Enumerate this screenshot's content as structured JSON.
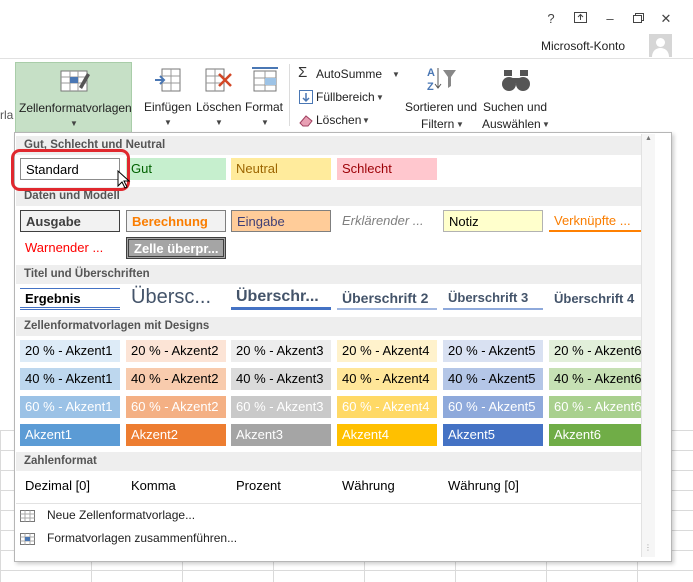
{
  "window": {
    "help": "?",
    "account": "Microsoft-Konto",
    "left_fragment": "rla"
  },
  "ribbon": {
    "zellenformat": "Zellenformatvorlagen",
    "einfuegen": "Einfügen",
    "loeschen": "Löschen",
    "format": "Format",
    "autosumme": "AutoSumme",
    "fuellbereich": "Füllbereich",
    "loeschen2": "Löschen",
    "sortieren1": "Sortieren und",
    "sortieren2": "Filtern",
    "suchen1": "Suchen und",
    "suchen2": "Auswählen"
  },
  "sections": [
    "Gut, Schlecht und Neutral",
    "Daten und Modell",
    "Titel und Überschriften",
    "Zellenformatvorlagen mit Designs",
    "Zahlenformat"
  ],
  "row1": [
    "Standard",
    "Gut",
    "Neutral",
    "Schlecht"
  ],
  "row2": [
    "Ausgabe",
    "Berechnung",
    "Eingabe",
    "Erklärender ...",
    "Notiz",
    "Verknüpfte ..."
  ],
  "row3": [
    "Warnender ...",
    "Zelle überpr..."
  ],
  "row4": [
    "Ergebnis",
    "Übersc...",
    "Überschr...",
    "Überschrift 2",
    "Überschrift 3",
    "Überschrift 4"
  ],
  "accent20": [
    "20 % - Akzent1",
    "20 % - Akzent2",
    "20 % - Akzent3",
    "20 % - Akzent4",
    "20 % - Akzent5",
    "20 % - Akzent6"
  ],
  "accent40": [
    "40 % - Akzent1",
    "40 % - Akzent2",
    "40 % - Akzent3",
    "40 % - Akzent4",
    "40 % - Akzent5",
    "40 % - Akzent6"
  ],
  "accent60": [
    "60 % - Akzent1",
    "60 % - Akzent2",
    "60 % - Akzent3",
    "60 % - Akzent4",
    "60 % - Akzent5",
    "60 % - Akzent6"
  ],
  "accent": [
    "Akzent1",
    "Akzent2",
    "Akzent3",
    "Akzent4",
    "Akzent5",
    "Akzent6"
  ],
  "numformat": [
    "Dezimal [0]",
    "Komma",
    "Prozent",
    "Währung",
    "Währung [0]"
  ],
  "menu": {
    "new_style": "Neue Zellenformatvorlage...",
    "merge": "Formatvorlagen zusammenführen..."
  },
  "colors": {
    "highlight": "#e0282e",
    "ribbon_selected": "#c6e0c6",
    "accent1": "#5b9bd5",
    "accent2": "#ed7d31",
    "accent3": "#a5a5a5",
    "accent4": "#ffc000",
    "accent5": "#4472c4",
    "accent6": "#70ad47"
  }
}
